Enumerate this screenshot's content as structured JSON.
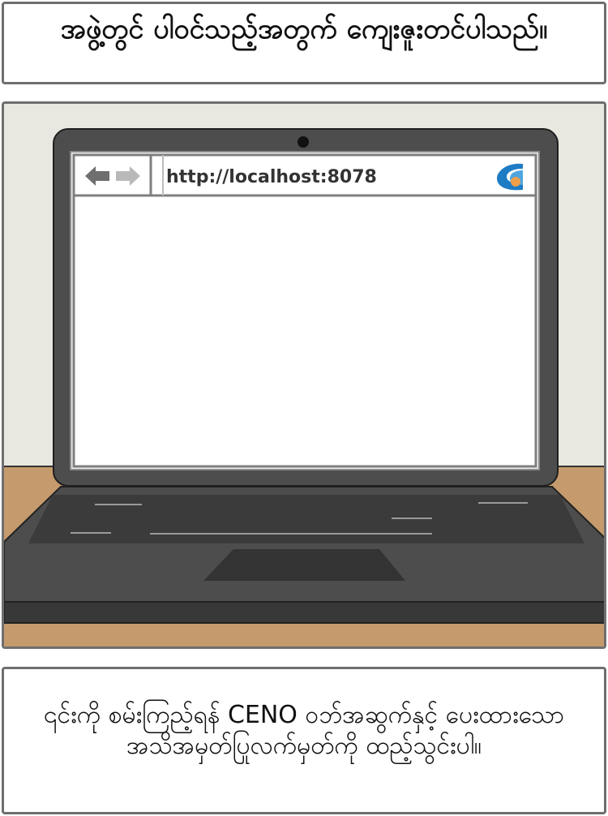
{
  "top_caption": "အဖွဲ့တွင် ပါဝင်သည့်အတွက် ကျေးဇူးတင်ပါသည်။",
  "browser": {
    "url": "http://localhost:8078",
    "back_icon": "back-arrow-icon",
    "forward_icon": "forward-arrow-icon",
    "logo_icon": "ceno-logo-icon"
  },
  "bottom_caption": "၎င်းကို စမ်းကြည့်ရန် CENO ဝဘ်အဆွက်နှင့် ပေးထားသော အသိအမှတ်ပြုလက်မှတ်ကို ထည့်သွင်းပါ။",
  "colors": {
    "wall": "#e9e8e0",
    "desk": "#c59b6d",
    "laptop_body": "#4d4d4d",
    "laptop_dark": "#3a3a3a",
    "logo_blue": "#1e7cc4",
    "logo_orange": "#f0a04b"
  }
}
